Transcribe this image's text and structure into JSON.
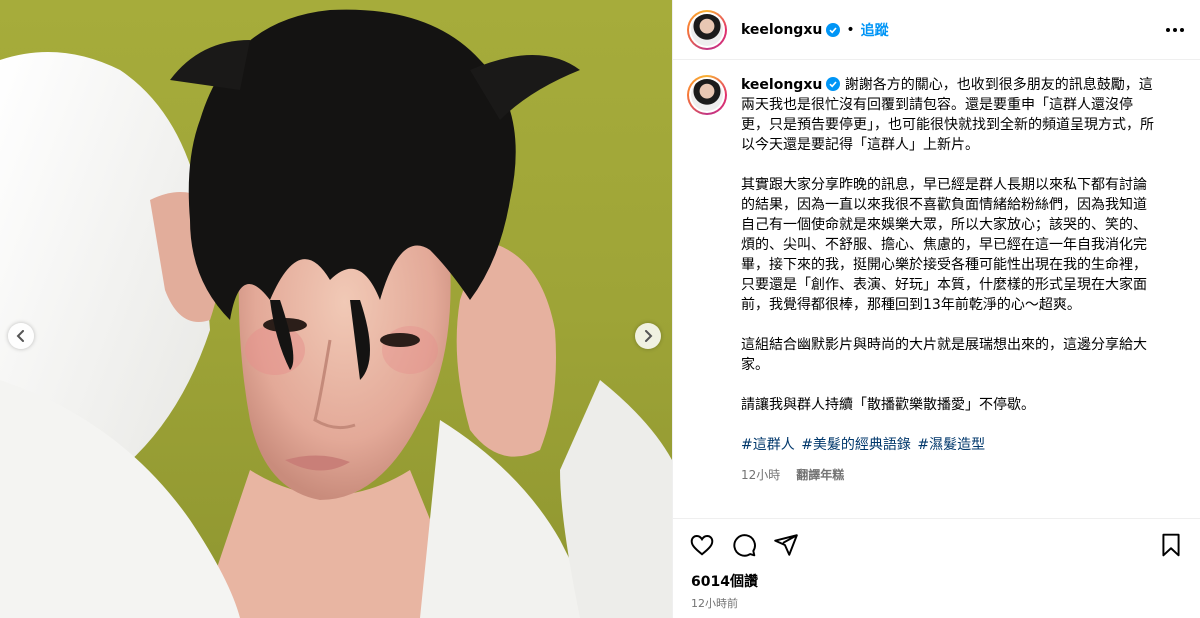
{
  "post": {
    "username": "keelongxu",
    "follow_label": "追蹤",
    "dot": "•",
    "caption_paragraphs": [
      "謝謝各方的關心，也收到很多朋友的訊息鼓勵，這兩天我也是很忙沒有回覆到請包容。還是要重申「這群人還沒停更，只是預告要停更」，也可能很快就找到全新的頻道呈現方式，所以今天還是要記得「這群人」上新片。",
      "其實跟大家分享昨晚的訊息，早已經是群人長期以來私下都有討論的結果，因為一直以來我很不喜歡負面情緒給粉絲們，因為我知道自己有一個使命就是來娛樂大眾，所以大家放心；該哭的、笑的、煩的、尖叫、不舒服、擔心、焦慮的，早已經在這一年自我消化完畢，接下來的我，挺開心樂於接受各種可能性出現在我的生命裡，只要還是「創作、表演、好玩」本質，什麼樣的形式呈現在大家面前，我覺得都很棒，那種回到13年前乾淨的心～超爽。",
      "這組結合幽默影片與時尚的大片就是展瑞想出來的，這邊分享給大家。",
      "請讓我與群人持續「散播歡樂散播愛」不停歇。"
    ],
    "hashtags": [
      "#這群人",
      "#美髮的經典語錄",
      "#濕髮造型"
    ],
    "caption_time": "12小時",
    "translate_label": "翻譯年糕",
    "views": "6014個讚",
    "posted_ago": "12小時前"
  },
  "icons": {
    "verified": "verified-badge-icon",
    "more": "more-options-icon",
    "like": "heart-icon",
    "comment": "comment-icon",
    "share": "paper-plane-icon",
    "save": "bookmark-icon",
    "prev": "chevron-left-icon",
    "next": "chevron-right-icon"
  },
  "colors": {
    "accent": "#0095f6",
    "hashtag": "#00376b",
    "muted": "#737373",
    "photo_background": "#a6ac3b"
  }
}
